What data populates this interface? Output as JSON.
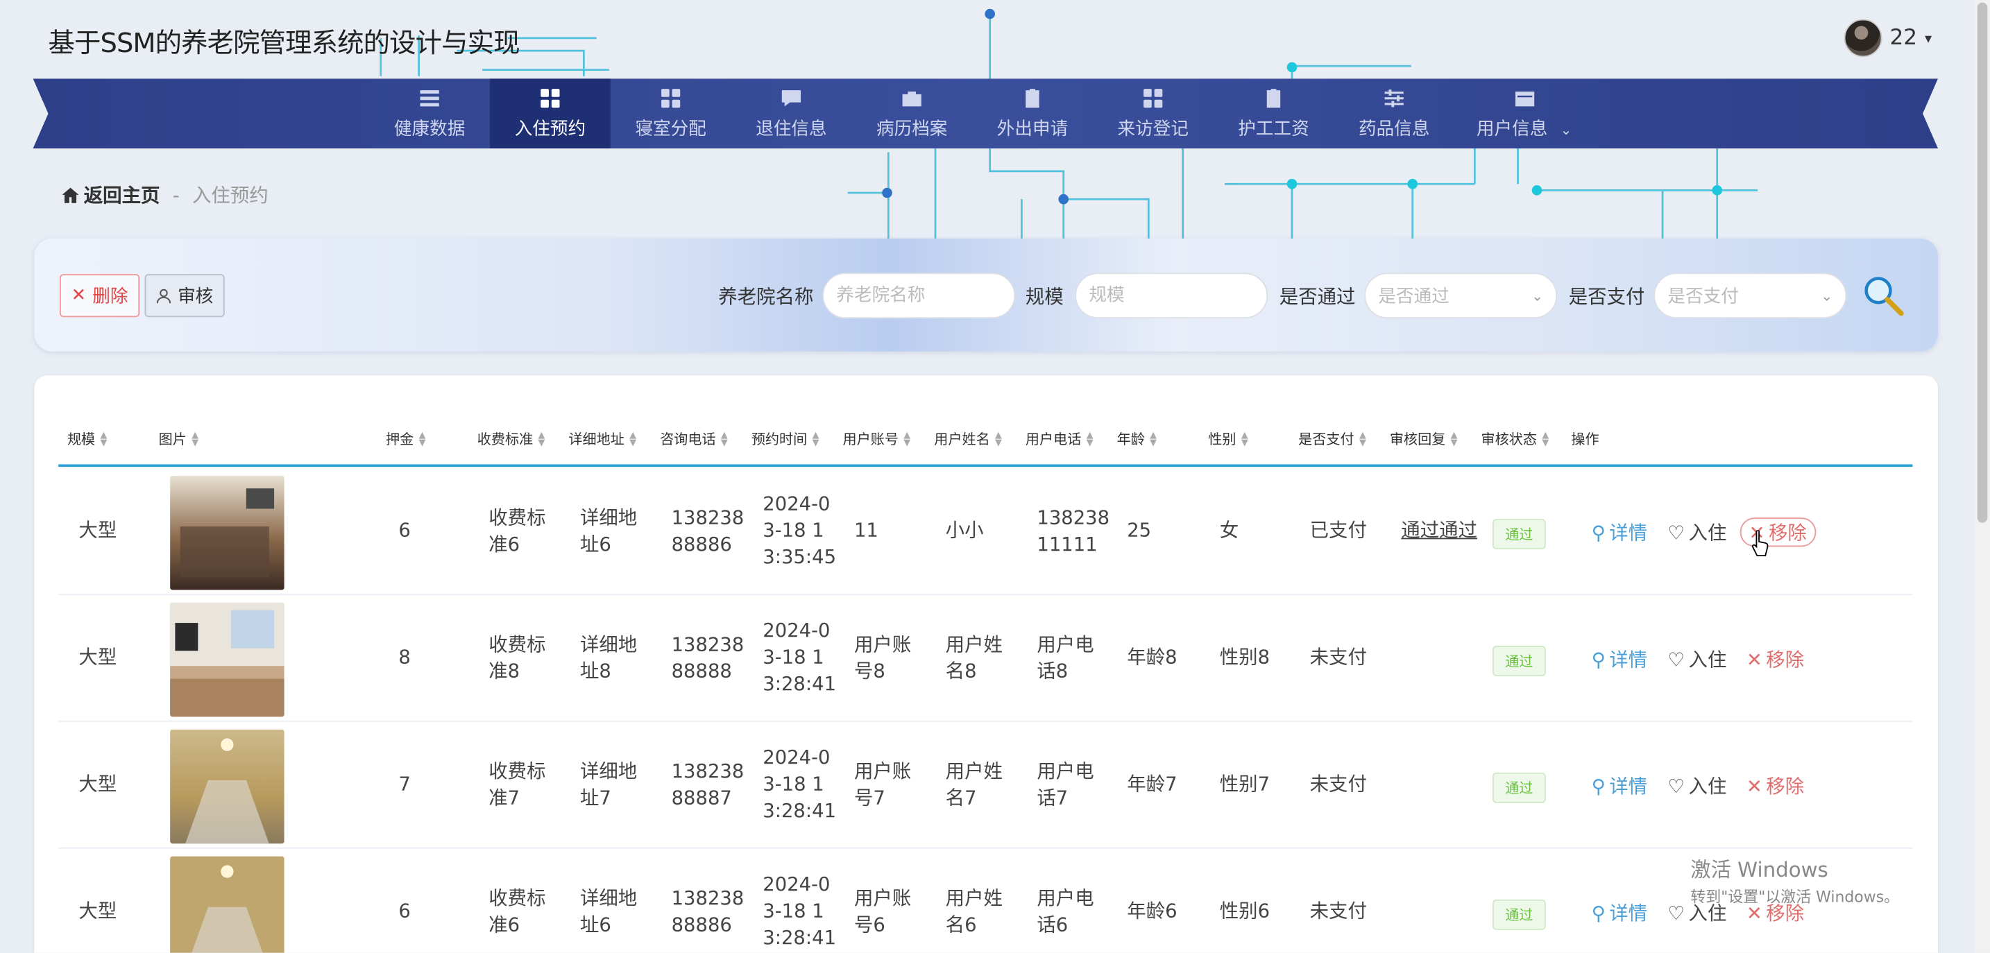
{
  "header": {
    "title": "基于SSM的养老院管理系统的设计与实现",
    "username": "22",
    "caret": "▾"
  },
  "nav": {
    "items": [
      {
        "label": "健康数据",
        "icon": "list-icon"
      },
      {
        "label": "入住预约",
        "icon": "grid-icon",
        "active": true
      },
      {
        "label": "寝室分配",
        "icon": "grid-icon"
      },
      {
        "label": "退住信息",
        "icon": "message-icon"
      },
      {
        "label": "病历档案",
        "icon": "briefcase-icon"
      },
      {
        "label": "外出申请",
        "icon": "clipboard-check-icon"
      },
      {
        "label": "来访登记",
        "icon": "grid-icon"
      },
      {
        "label": "护工工资",
        "icon": "clipboard-icon"
      },
      {
        "label": "药品信息",
        "icon": "sliders-icon"
      },
      {
        "label": "用户信息",
        "icon": "card-icon",
        "has_more": true
      }
    ],
    "more_chevron": "⌄"
  },
  "breadcrumb": {
    "home": "返回主页",
    "separator": "-",
    "current": "入住预约"
  },
  "toolbar": {
    "delete_label": "删除",
    "audit_label": "审核"
  },
  "search": {
    "name_label": "养老院名称",
    "name_placeholder": "养老院名称",
    "scale_label": "规模",
    "scale_placeholder": "规模",
    "passed_label": "是否通过",
    "passed_placeholder": "是否通过",
    "paid_label": "是否支付",
    "paid_placeholder": "是否支付"
  },
  "table": {
    "headers": [
      "规模",
      "图片",
      "押金",
      "收费标准",
      "详细地址",
      "咨询电话",
      "预约时间",
      "用户账号",
      "用户姓名",
      "用户电话",
      "年龄",
      "性别",
      "是否支付",
      "审核回复",
      "审核状态",
      "操作"
    ],
    "actions": {
      "detail": "详情",
      "checkin": "入住",
      "remove": "移除"
    },
    "rows": [
      {
        "scale": "大型",
        "deposit": "6",
        "fee": [
          "收费标",
          "准6"
        ],
        "address": [
          "详细地",
          "址6"
        ],
        "phone": [
          "138238",
          "88886"
        ],
        "time": [
          "2024-0",
          "3-18 1",
          "3:35:45"
        ],
        "account": [
          "11"
        ],
        "name": [
          "小小"
        ],
        "uphone": [
          "138238",
          "11111"
        ],
        "age": "25",
        "gender": "女",
        "paid": "已支付",
        "reply": "通过通过",
        "status": "通过"
      },
      {
        "scale": "大型",
        "deposit": "8",
        "fee": [
          "收费标",
          "准8"
        ],
        "address": [
          "详细地",
          "址8"
        ],
        "phone": [
          "138238",
          "88888"
        ],
        "time": [
          "2024-0",
          "3-18 1",
          "3:28:41"
        ],
        "account": [
          "用户账",
          "号8"
        ],
        "name": [
          "用户姓",
          "名8"
        ],
        "uphone": [
          "用户电",
          "话8"
        ],
        "age": "年龄8",
        "gender": "性别8",
        "paid": "未支付",
        "reply": "",
        "status": "通过"
      },
      {
        "scale": "大型",
        "deposit": "7",
        "fee": [
          "收费标",
          "准7"
        ],
        "address": [
          "详细地",
          "址7"
        ],
        "phone": [
          "138238",
          "88887"
        ],
        "time": [
          "2024-0",
          "3-18 1",
          "3:28:41"
        ],
        "account": [
          "用户账",
          "号7"
        ],
        "name": [
          "用户姓",
          "名7"
        ],
        "uphone": [
          "用户电",
          "话7"
        ],
        "age": "年龄7",
        "gender": "性别7",
        "paid": "未支付",
        "reply": "",
        "status": "通过"
      },
      {
        "scale": "大型",
        "deposit": "6",
        "fee": [
          "收费标",
          "准6"
        ],
        "address": [
          "详细地",
          "址6"
        ],
        "phone": [
          "138238",
          "88886"
        ],
        "time": [
          "2024-0",
          "3-18 1",
          "3:28:41"
        ],
        "account": [
          "用户账",
          "号6"
        ],
        "name": [
          "用户姓",
          "名6"
        ],
        "uphone": [
          "用户电",
          "话6"
        ],
        "age": "年龄6",
        "gender": "性别6",
        "paid": "未支付",
        "reply": "",
        "status": "通过"
      }
    ]
  },
  "watermark": {
    "line1": "激活 Windows",
    "line2": "转到\"设置\"以激活 Windows。"
  },
  "colors": {
    "nav_bg": "#2e3f8a",
    "nav_active": "#1f2f74",
    "accent_line": "#2aa0d8",
    "success": "#67c23a",
    "danger": "#e04646",
    "link": "#4a9fd8"
  }
}
